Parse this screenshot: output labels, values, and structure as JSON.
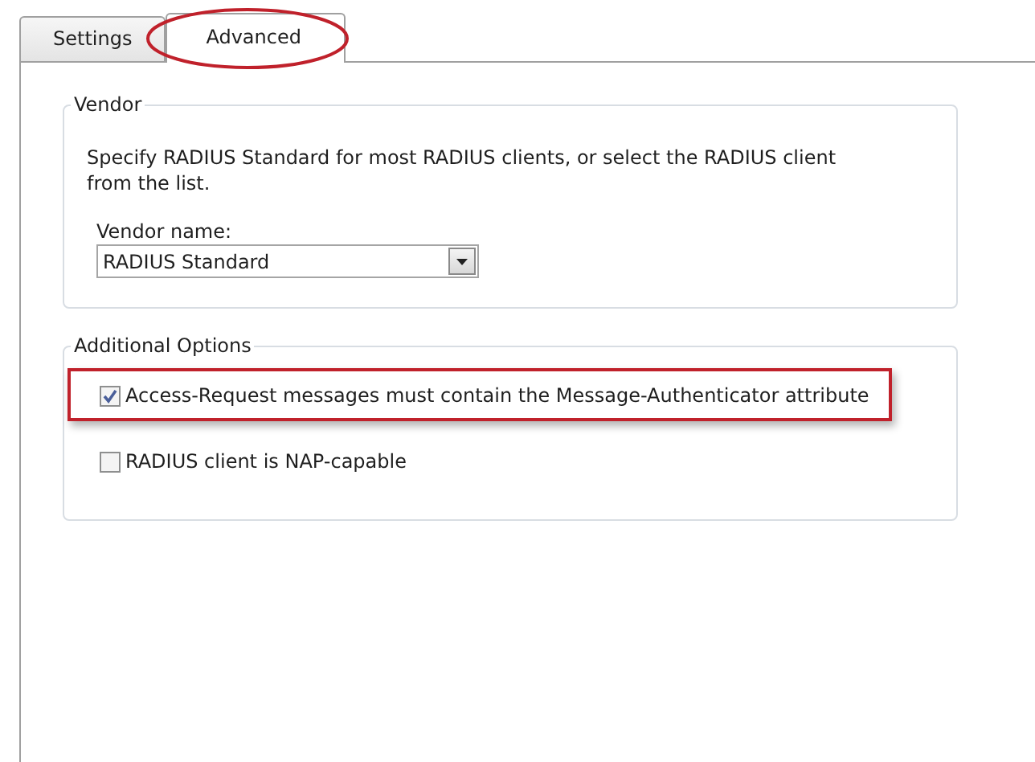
{
  "tabs": [
    {
      "label": "Settings",
      "selected": false,
      "highlighted": false
    },
    {
      "label": "Advanced",
      "selected": true,
      "highlighted": true
    }
  ],
  "vendor": {
    "legend": "Vendor",
    "description": "Specify RADIUS Standard for most RADIUS clients, or select the RADIUS client from the list.",
    "field_label": "Vendor name:",
    "value": "RADIUS Standard"
  },
  "additional_options": {
    "legend": "Additional Options",
    "options": [
      {
        "label": "Access-Request messages must contain the Message-Authenticator attribute",
        "checked": true,
        "highlighted": true
      },
      {
        "label": "RADIUS client is NAP-capable",
        "checked": false,
        "highlighted": false
      }
    ]
  }
}
